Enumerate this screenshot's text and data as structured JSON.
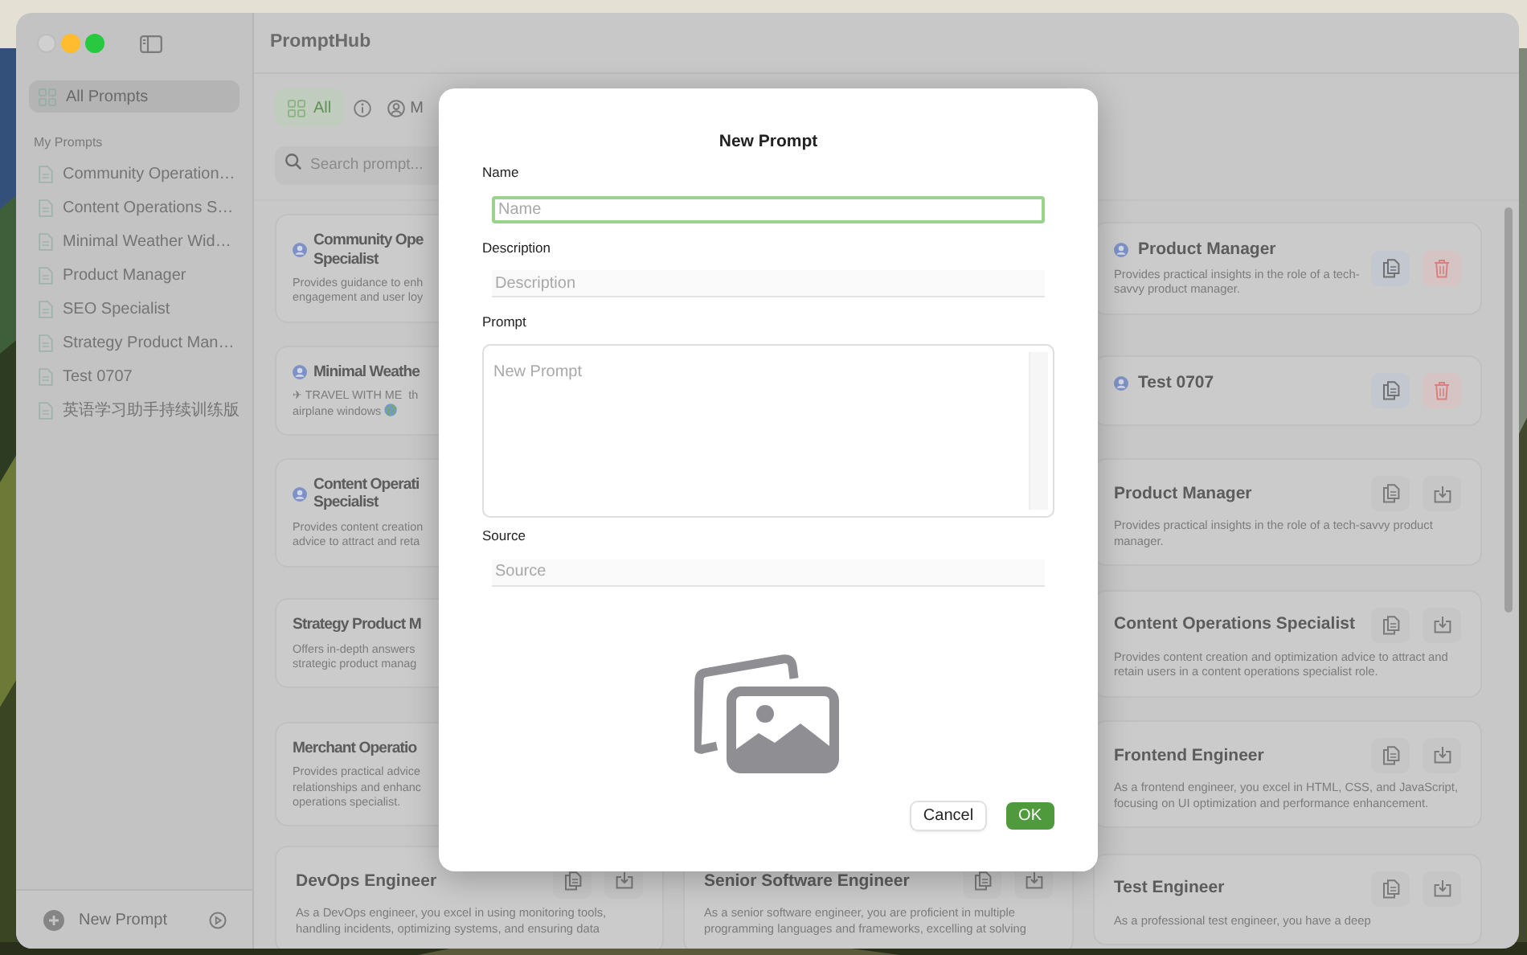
{
  "window_controls": [
    {
      "kind": "close",
      "disabled": true
    },
    {
      "kind": "minimize",
      "disabled": false
    },
    {
      "kind": "zoom",
      "disabled": false
    }
  ],
  "sidebar": {
    "items": [
      {
        "label": "All Prompts",
        "selected": true
      }
    ],
    "section": "My Prompts",
    "prompts": [
      {
        "label": "Community Operation…",
        "selected": false
      },
      {
        "label": "Content Operations S…",
        "selected": false
      },
      {
        "label": "Minimal Weather Wid…",
        "selected": false
      },
      {
        "label": "Product Manager",
        "selected": false
      },
      {
        "label": "SEO Specialist",
        "selected": false
      },
      {
        "label": "Strategy Product Man…",
        "selected": false
      },
      {
        "label": "Test 0707",
        "selected": false
      },
      {
        "label": "英语学习助手持续训练版",
        "selected": false
      }
    ],
    "footer_button": "New Prompt"
  },
  "app_title": "PromptHub",
  "filters": [
    {
      "kind": "all",
      "label": "All",
      "selected": true
    },
    {
      "kind": "info",
      "selected": false
    },
    {
      "kind": "mine",
      "label": "M",
      "selected": false
    }
  ],
  "search": {
    "placeholder": "Search prompt..."
  },
  "card_rows": [
    {
      "left": {
        "title": "Community Ope\nSpecialist",
        "description": "Provides guidance to enh\nengagement and user loy",
        "owned": true
      },
      "right": {
        "title": "Product Manager",
        "description": "Provides practical insights in the role of a tech-savvy product manager.",
        "owned": true,
        "actions": [
          {
            "kind": "copy"
          },
          {
            "kind": "delete"
          }
        ]
      }
    },
    {
      "left": {
        "title": "Minimal Weathe",
        "description": "✈ TRAVEL WITH ME  th\nairplane windows",
        "owned": true,
        "end_icon": {
          "kind": "globe"
        }
      },
      "right": {
        "title": "Test 0707",
        "owned": true,
        "actions": [
          {
            "kind": "copy"
          },
          {
            "kind": "delete"
          }
        ]
      }
    },
    {
      "left": {
        "title": "Content Operati\nSpecialist",
        "description": "Provides content creation\nadvice to attract and reta",
        "owned": true
      },
      "right": {
        "title": "Product Manager",
        "description": "Provides practical insights in the role of a tech-savvy product manager.",
        "owned": false,
        "actions": [
          {
            "kind": "copy"
          },
          {
            "kind": "download"
          }
        ]
      }
    },
    {
      "left": {
        "title": "Strategy Product M",
        "description": "Offers in-depth answers\nstrategic product manag",
        "owned": false
      },
      "right": {
        "title": "Content Operations Specialist",
        "description": "Provides content creation and optimization advice to attract and retain users in a content operations specialist role.",
        "owned": false,
        "actions": [
          {
            "kind": "copy"
          },
          {
            "kind": "download"
          }
        ]
      }
    },
    {
      "left": {
        "title": "Merchant Operatio",
        "description": "Provides practical advice\nrelationships and enhanc\noperations specialist.",
        "owned": false
      },
      "right": {
        "title": "Frontend Engineer",
        "description": "As a frontend engineer, you excel in HTML, CSS, and JavaScript, focusing on UI optimization and performance enhancement.",
        "owned": false,
        "actions": [
          {
            "kind": "copy"
          },
          {
            "kind": "download"
          }
        ]
      }
    },
    {
      "left": {
        "title": "DevOps Engineer",
        "description": "As a DevOps engineer, you excel in using monitoring tools,\nhandling incidents, optimizing systems, and ensuring data",
        "owned": false,
        "actions": [
          {
            "kind": "copy"
          },
          {
            "kind": "download"
          }
        ]
      },
      "middle": {
        "title": "Senior Software Engineer",
        "description": "As a senior software engineer, you are proficient in multiple\nprogramming languages and frameworks, excelling at solving",
        "owned": false,
        "actions": [
          {
            "kind": "copy"
          },
          {
            "kind": "download"
          }
        ]
      },
      "right": {
        "title": "Test Engineer",
        "description": "As a professional test engineer, you have a deep",
        "owned": false,
        "actions": [
          {
            "kind": "copy"
          },
          {
            "kind": "download"
          }
        ]
      }
    }
  ],
  "dialog": {
    "title": "New Prompt",
    "fields": [
      {
        "label": "Name",
        "placeholder": "Name",
        "kind": "line",
        "focused": true
      },
      {
        "label": "Description",
        "placeholder": "Description",
        "kind": "line",
        "focused": false
      },
      {
        "label": "Prompt",
        "placeholder": "New Prompt",
        "kind": "area",
        "focused": false
      },
      {
        "label": "Source",
        "placeholder": "Source",
        "kind": "line",
        "focused": false
      }
    ],
    "buttons": [
      {
        "label": "Cancel",
        "kind": "secondary"
      },
      {
        "label": "OK",
        "kind": "primary"
      }
    ]
  }
}
